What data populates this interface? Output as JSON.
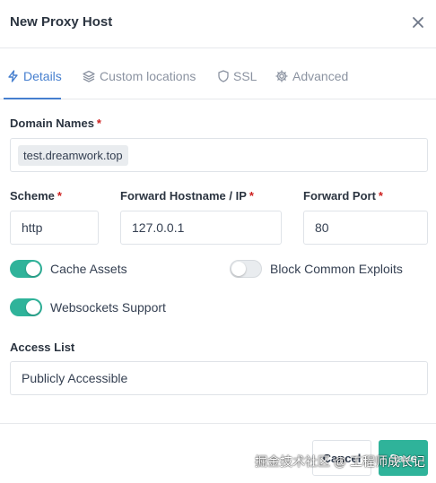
{
  "modal": {
    "title": "New Proxy Host"
  },
  "tabs": [
    {
      "label": "Details",
      "icon": "lightning-icon",
      "active": true
    },
    {
      "label": "Custom locations",
      "icon": "layers-icon",
      "active": false
    },
    {
      "label": "SSL",
      "icon": "shield-icon",
      "active": false
    },
    {
      "label": "Advanced",
      "icon": "gear-icon",
      "active": false
    }
  ],
  "form": {
    "domain_names": {
      "label": "Domain Names",
      "required": "*",
      "values": [
        "test.dreamwork.top"
      ]
    },
    "scheme": {
      "label": "Scheme",
      "required": "*",
      "value": "http"
    },
    "forward_hostname": {
      "label": "Forward Hostname / IP",
      "required": "*",
      "value": "127.0.0.1"
    },
    "forward_port": {
      "label": "Forward Port",
      "required": "*",
      "value": "80"
    },
    "cache_assets": {
      "label": "Cache Assets",
      "on": true
    },
    "block_exploits": {
      "label": "Block Common Exploits",
      "on": false
    },
    "websockets": {
      "label": "Websockets Support",
      "on": true
    },
    "access_list": {
      "label": "Access List",
      "value": "Publicly Accessible"
    }
  },
  "footer": {
    "cancel_label": "Cancel",
    "save_label": "Save"
  },
  "watermark": "掘金技术社区 @ 工程师成长记",
  "colors": {
    "accent": "#467fcf",
    "toggle_on": "#2fb39a",
    "required": "#cd201f"
  }
}
